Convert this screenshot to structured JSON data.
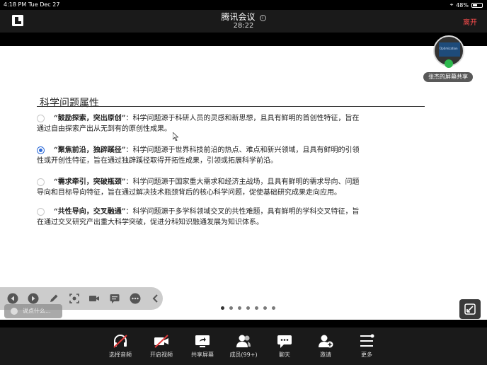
{
  "status_bar": {
    "time": "4:18 PM",
    "date": "Tue Dec 27",
    "battery": "48%"
  },
  "header": {
    "title": "腾讯会议",
    "timer": "28:22",
    "leave_label": "离开"
  },
  "slide": {
    "title": "科学问题属性",
    "items": [
      {
        "lead": "“鼓励探索，突出原创”",
        "line1": "：科学问题源于科研人员的灵感和新思想，且具有鲜明的首创性特征，旨在",
        "line2": "通过自由探索产出从无到有的原创性成果。",
        "selected": false
      },
      {
        "lead": "“聚焦前沿，独辟蹊径”",
        "line1": "：科学问题源于世界科技前沿的热点、难点和新兴领域，且具有鲜明的引领",
        "line2": "性或开创性特征，旨在通过独辟蹊径取得开拓性成果，引领或拓展科学前沿。",
        "selected": true
      },
      {
        "lead": "“需求牵引，突破瓶颈”",
        "line1": "：科学问题源于国家重大需求和经济主战场，且具有鲜明的需求导向、问题",
        "line2": "导向和目标导向特征，旨在通过解决技术瓶颈背后的核心科学问题，促使基础研究成果走向应用。",
        "selected": false
      },
      {
        "lead": "“共性导向，交叉融通”",
        "line1": "：科学问题源于多学科领域交叉的共性难题，具有鲜明的学科交叉特征，旨",
        "line2": "在通过交叉研究产出重大科学突破，促进分科知识融通发展为知识体系。",
        "selected": false
      }
    ]
  },
  "participant": {
    "label": "张杰的屏幕共享",
    "screen_text": "Optimization"
  },
  "chat": {
    "placeholder": "说点什么..."
  },
  "pager": {
    "count": 7,
    "active": 0
  },
  "toolbar": {
    "items": [
      {
        "label": "选择音频",
        "icon": "headset-muted-icon"
      },
      {
        "label": "开启视频",
        "icon": "camera-off-icon"
      },
      {
        "label": "共享屏幕",
        "icon": "share-screen-icon"
      },
      {
        "label": "成员(99+)",
        "icon": "members-icon"
      },
      {
        "label": "聊天",
        "icon": "chat-icon"
      },
      {
        "label": "邀请",
        "icon": "invite-icon"
      },
      {
        "label": "更多",
        "icon": "more-icon"
      }
    ]
  },
  "colors": {
    "accent_blue": "#2e6bd8",
    "leave_red": "#ff4d4d",
    "mute_red": "#e03b3b"
  }
}
